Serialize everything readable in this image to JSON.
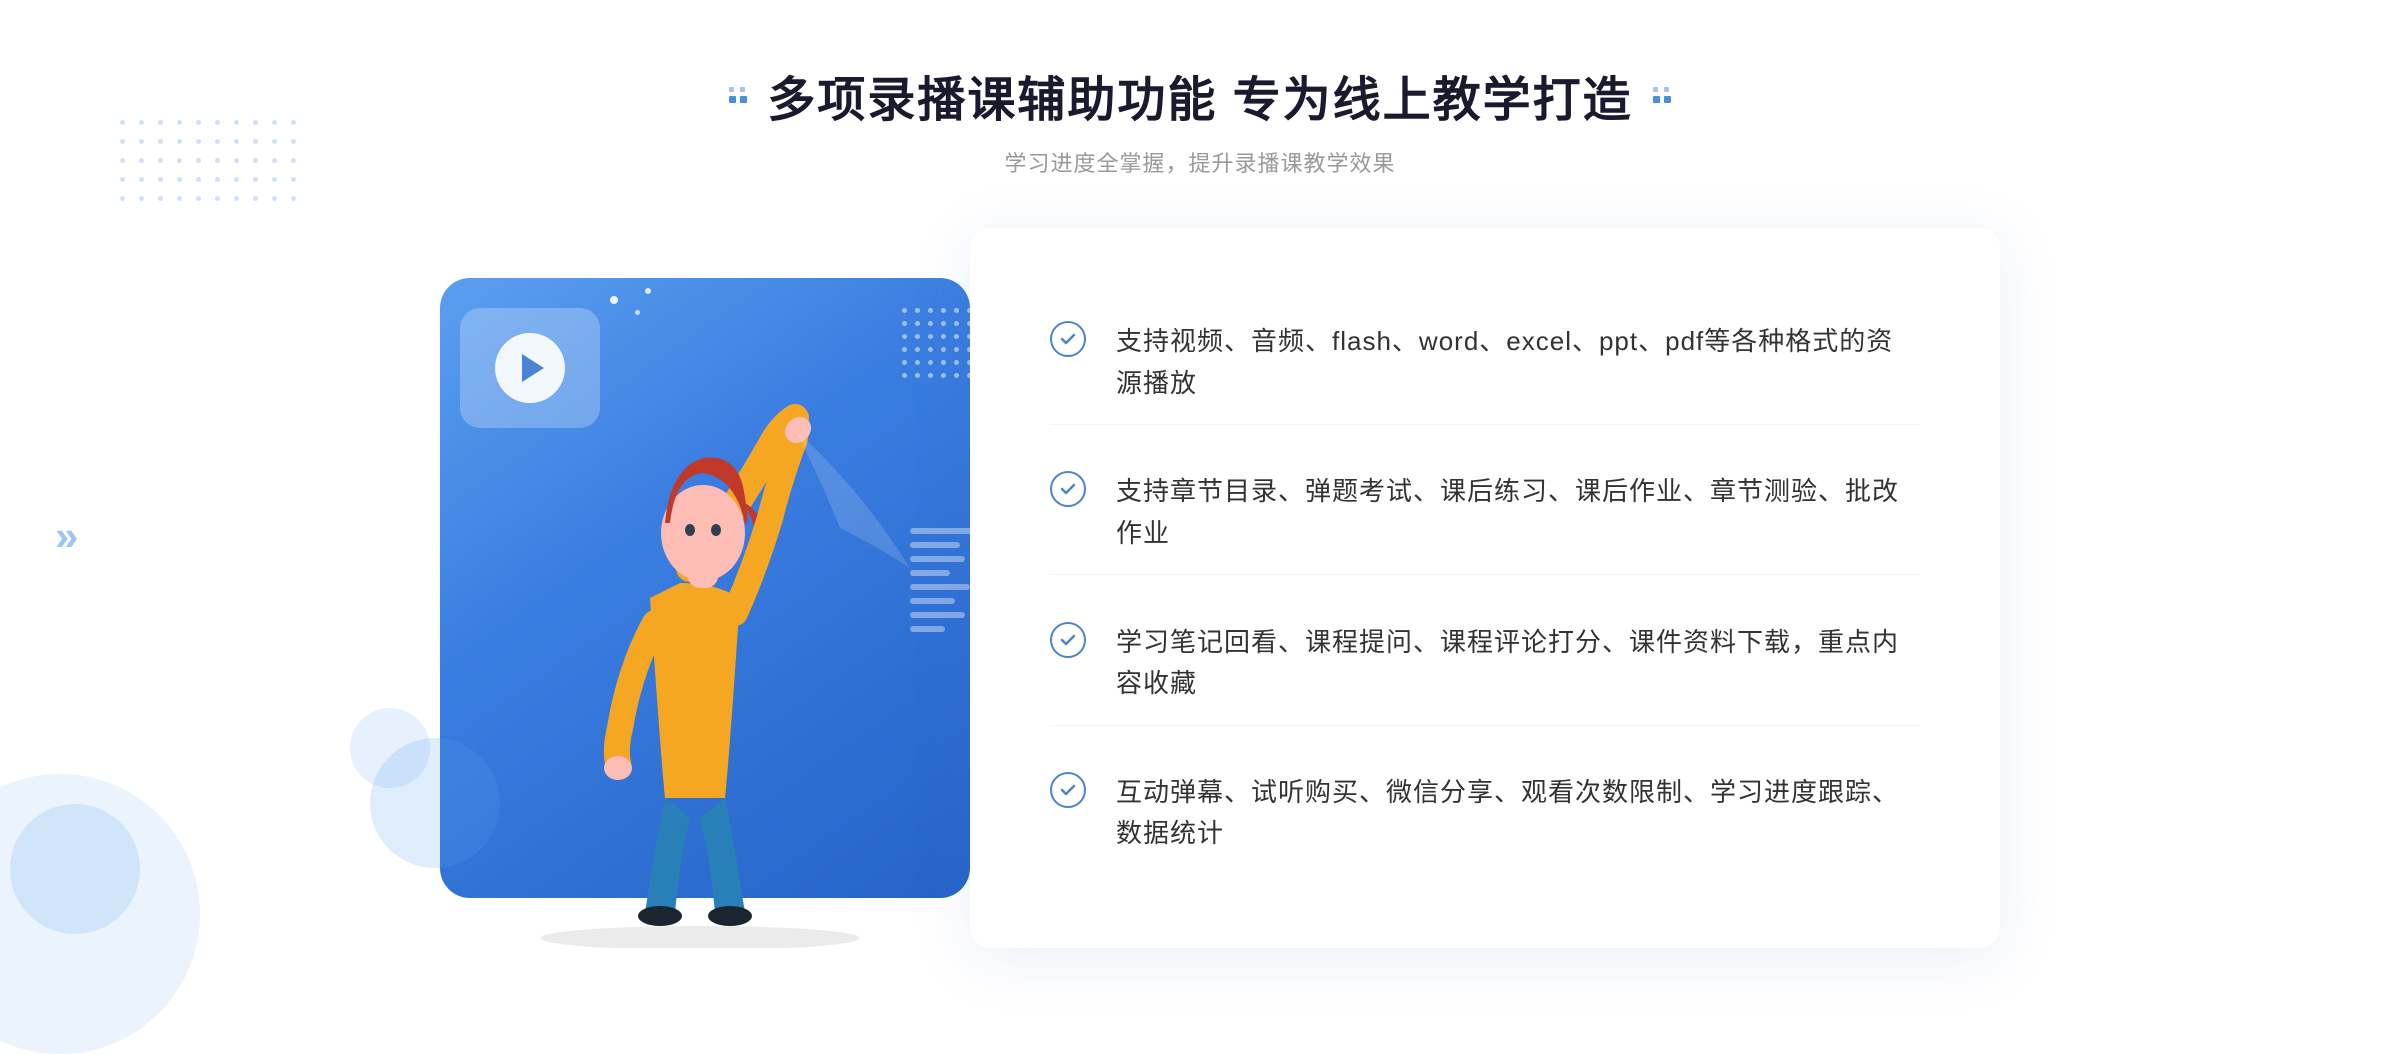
{
  "header": {
    "title": "多项录播课辅助功能 专为线上教学打造",
    "subtitle": "学习进度全掌握，提升录播课教学效果",
    "decorator_left": "❖",
    "decorator_right": "❖"
  },
  "features": [
    {
      "id": 1,
      "text": "支持视频、音频、flash、word、excel、ppt、pdf等各种格式的资源播放"
    },
    {
      "id": 2,
      "text": "支持章节目录、弹题考试、课后练习、课后作业、章节测验、批改作业"
    },
    {
      "id": 3,
      "text": "学习笔记回看、课程提问、课程评论打分、课件资料下载，重点内容收藏"
    },
    {
      "id": 4,
      "text": "互动弹幕、试听购买、微信分享、观看次数限制、学习进度跟踪、数据统计"
    }
  ],
  "colors": {
    "primary_blue": "#3a7de0",
    "light_blue": "#5b9ef0",
    "check_color": "#4a85d4",
    "text_dark": "#1a1a2e",
    "text_gray": "#999999",
    "text_body": "#333333"
  }
}
